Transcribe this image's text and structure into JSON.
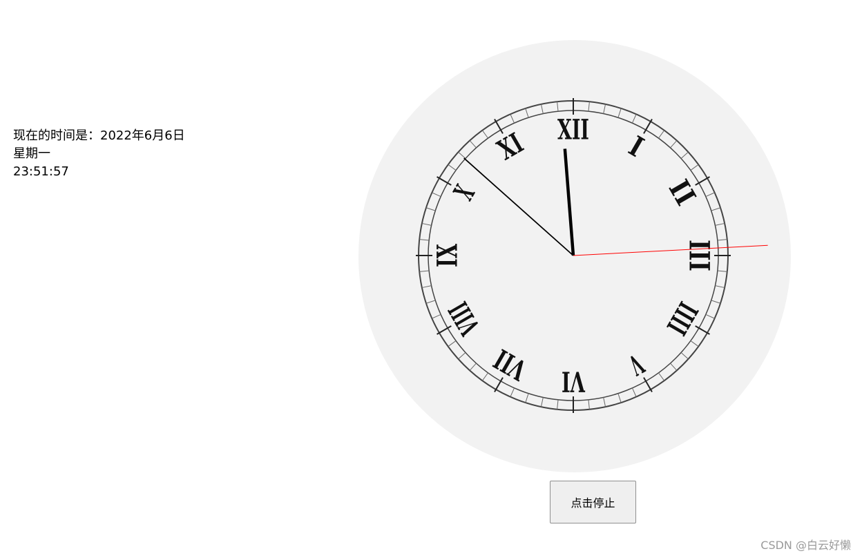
{
  "time_display": {
    "date_line": "现在的时间是：2022年6月6日",
    "weekday": "星期一",
    "time": "23:51:57"
  },
  "clock": {
    "numerals": [
      "XII",
      "I",
      "II",
      "III",
      "IIII",
      "V",
      "VI",
      "VII",
      "VIII",
      "IX",
      "X",
      "XI"
    ],
    "time": {
      "hours": 23,
      "minutes": 51,
      "seconds": 57
    },
    "colors": {
      "face": "#f2f2f2",
      "hands": "#000000",
      "second_hand": "#ff0000"
    }
  },
  "controls": {
    "stop_button_label": "点击停止"
  },
  "watermark": {
    "text": "CSDN @白云好懒"
  }
}
